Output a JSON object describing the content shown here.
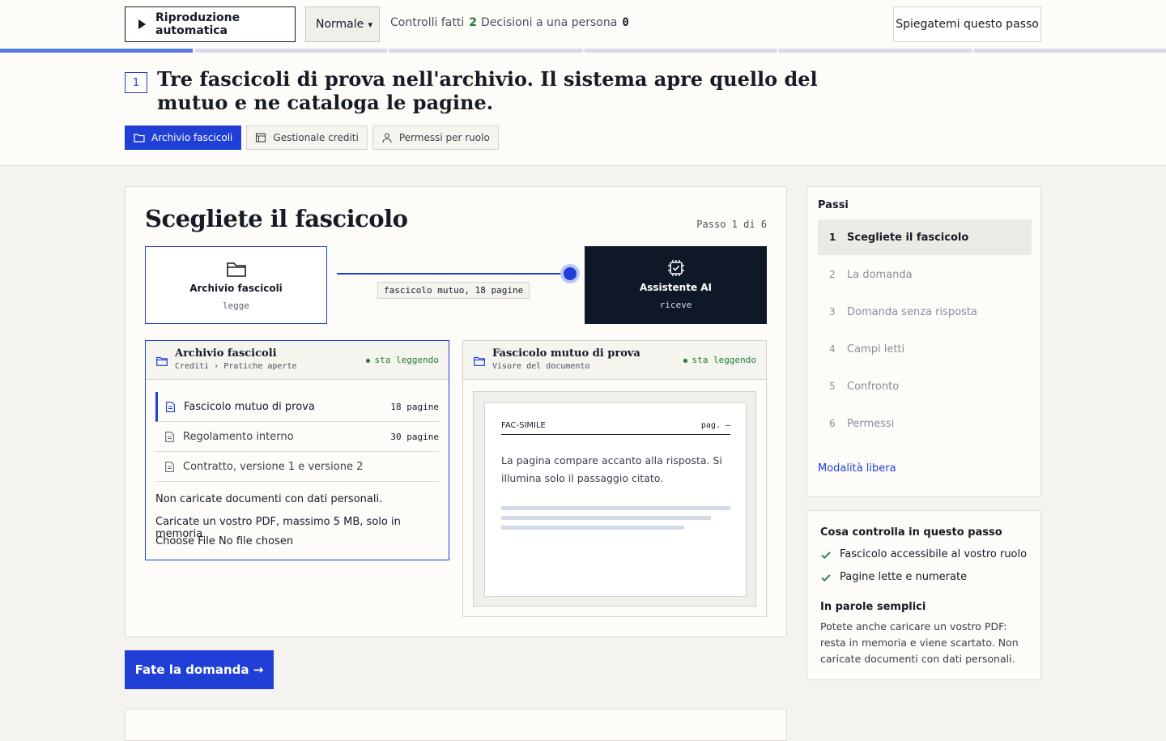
{
  "toolbar": {
    "autoplay_label": "Riproduzione automatica",
    "speed_selected": "Normale",
    "checks_done_label": "Controlli fatti",
    "checks_done_count": "2",
    "decisions_label": "Decisioni a una persona",
    "decisions_count": "0",
    "explain_label": "Spiegatemi questo passo"
  },
  "progress": {
    "total_steps": 6,
    "current_step": 1
  },
  "header": {
    "step_number": "1",
    "headline": "Tre fascicoli di prova nell'archivio. Il sistema apre quello del mutuo e ne cataloga le pagine.",
    "systems": [
      {
        "label": "Archivio fascicoli",
        "icon": "folder-icon",
        "active": true
      },
      {
        "label": "Gestionale crediti",
        "icon": "table-icon",
        "active": false
      },
      {
        "label": "Permessi per ruolo",
        "icon": "user-icon",
        "active": false
      }
    ]
  },
  "main": {
    "title": "Scegliete il fascicolo",
    "step_indicator": "Passo 1 di 6",
    "flow": {
      "source": {
        "label": "Archivio fascicoli",
        "action": "legge",
        "icon": "folder-icon"
      },
      "payload": "fascicolo mutuo, 18 pagine",
      "target": {
        "label": "Assistente AI",
        "action": "riceve",
        "icon": "chip-icon"
      }
    },
    "archive_panel": {
      "title": "Archivio fascicoli",
      "path": "Crediti › Pratiche aperte",
      "status": "sta leggendo",
      "files": [
        {
          "name": "Fascicolo mutuo di prova",
          "pages": "18 pagine",
          "selected": true
        },
        {
          "name": "Regolamento interno",
          "pages": "30 pagine",
          "selected": false
        },
        {
          "name": "Contratto, versione 1 e versione 2",
          "pages": "",
          "selected": false
        }
      ],
      "warning": "Non caricate documenti con dati personali.",
      "upload_label": "Caricate un vostro PDF, massimo 5 MB, solo in memoria",
      "file_button": "Choose File",
      "file_status": "No file chosen"
    },
    "viewer_panel": {
      "title": "Fascicolo mutuo di prova",
      "subtitle": "Visore del documento",
      "status": "sta leggendo",
      "page_header_left": "FAC-SIMILE",
      "page_header_right": "pag. —",
      "page_text": "La pagina compare accanto alla risposta. Si illumina solo il passaggio citato."
    },
    "cta_label": "Fate la domanda →"
  },
  "sidebar": {
    "steps_heading": "Passi",
    "steps": [
      {
        "num": "1",
        "label": "Scegliete il fascicolo",
        "active": true
      },
      {
        "num": "2",
        "label": "La domanda",
        "active": false
      },
      {
        "num": "3",
        "label": "Domanda senza risposta",
        "active": false
      },
      {
        "num": "4",
        "label": "Campi letti",
        "active": false
      },
      {
        "num": "5",
        "label": "Confronto",
        "active": false
      },
      {
        "num": "6",
        "label": "Permessi",
        "active": false
      }
    ],
    "free_mode_label": "Modalità libera",
    "checks_heading": "Cosa controlla in questo passo",
    "checks": [
      "Fascicolo accessibile al vostro ruolo",
      "Pagine lette e numerate"
    ],
    "plain_heading": "In parole semplici",
    "plain_text": "Potete anche caricare un vostro PDF: resta in memoria e viene scartato. Non caricate documenti con dati personali."
  },
  "colors": {
    "accent": "#1f3fd6",
    "dark": "#0e1826",
    "ok": "#1f7a3c"
  }
}
